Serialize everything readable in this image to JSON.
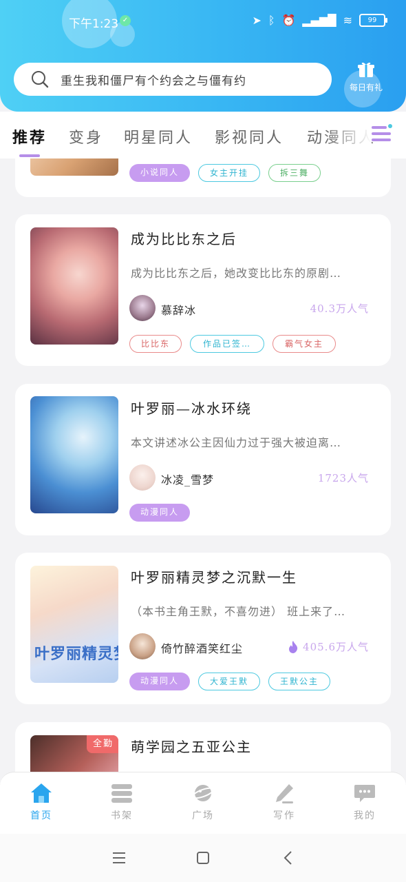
{
  "status_bar": {
    "time": "下午1:23",
    "battery": "99"
  },
  "search": {
    "placeholder": "重生我和僵尸有个约会之与僵有约"
  },
  "daily_gift": {
    "label": "每日有礼"
  },
  "tabs": [
    {
      "label": "推荐",
      "active": true
    },
    {
      "label": "变身",
      "active": false
    },
    {
      "label": "明星同人",
      "active": false
    },
    {
      "label": "影视同人",
      "active": false
    },
    {
      "label": "动漫同人",
      "active": false
    }
  ],
  "books": [
    {
      "partial": true,
      "tags": [
        {
          "label": "小说同人",
          "style": "purple"
        },
        {
          "label": "女主开挂",
          "style": "cyan"
        },
        {
          "label": "拆三舞",
          "style": "green"
        }
      ]
    },
    {
      "title": "成为比比东之后",
      "description": "成为比比东之后，她改变比比东的原剧…",
      "author": "慕辞冰",
      "popularity": "40.3万人气",
      "hot": false,
      "tags": [
        {
          "label": "比比东",
          "style": "red"
        },
        {
          "label": "作品已签…",
          "style": "cyan"
        },
        {
          "label": "霸气女主",
          "style": "red"
        }
      ]
    },
    {
      "title": "叶罗丽—冰水环绕",
      "description": "本文讲述冰公主因仙力过于强大被迫离…",
      "author": "冰凌_雪梦",
      "popularity": "1723人气",
      "hot": false,
      "tags": [
        {
          "label": "动漫同人",
          "style": "purple"
        }
      ]
    },
    {
      "title": "叶罗丽精灵梦之沉默一生",
      "description": "（本书主角王默，不喜勿进） 班上来了…",
      "author": "倚竹醉酒笑红尘",
      "popularity": "405.6万人气",
      "hot": true,
      "cover_text": "叶罗丽精灵梦",
      "tags": [
        {
          "label": "动漫同人",
          "style": "purple"
        },
        {
          "label": "大爱王默",
          "style": "cyan"
        },
        {
          "label": "王默公主",
          "style": "cyan"
        }
      ]
    },
    {
      "title": "萌学园之五亚公主",
      "badge": "全勤"
    }
  ],
  "bottom_nav": [
    {
      "label": "首页",
      "icon": "home-icon",
      "active": true
    },
    {
      "label": "书架",
      "icon": "bookshelf-icon",
      "active": false
    },
    {
      "label": "广场",
      "icon": "planet-icon",
      "active": false
    },
    {
      "label": "写作",
      "icon": "pen-icon",
      "active": false
    },
    {
      "label": "我的",
      "icon": "chat-icon",
      "active": false
    }
  ],
  "colors": {
    "header_gradient_start": "#4fd0f5",
    "header_gradient_end": "#2a9ff0",
    "accent_purple": "#c79cf0",
    "nav_active": "#2aa5ee",
    "popularity": "#c8a6ec"
  }
}
